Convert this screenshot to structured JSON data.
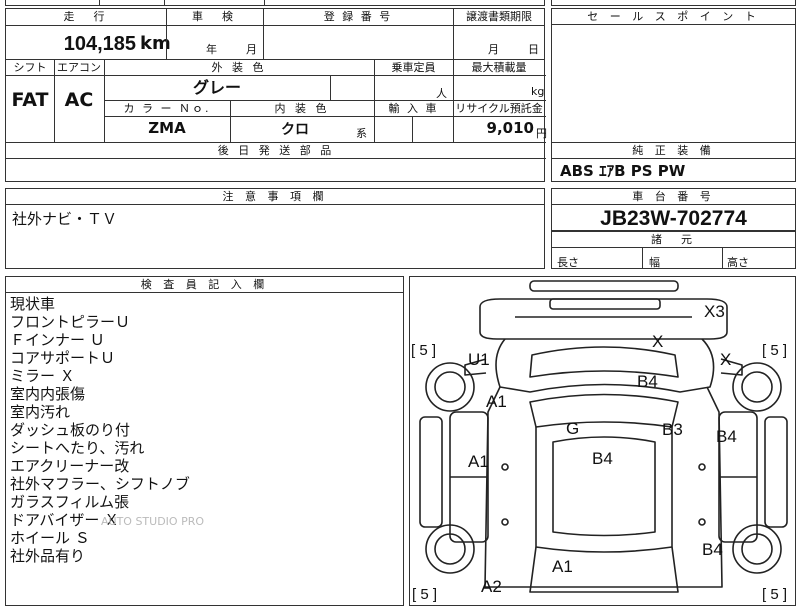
{
  "header": {
    "top_fragments": [
      "",
      "",
      ""
    ]
  },
  "vehicle_info": {
    "mileage_label": "走　行",
    "mileage_value": "104,185",
    "mileage_unit": "km",
    "inspection_label": "車　検",
    "inspection_year_unit": "年",
    "inspection_month_unit": "月",
    "registration_label": "登 録 番 号",
    "transfer_label": "譲渡書類期限",
    "transfer_month_unit": "月",
    "transfer_day_unit": "日",
    "shift_label": "シフト",
    "shift_value": "FAT",
    "aircon_label": "エアコン",
    "aircon_value": "AC",
    "exterior_color_label": "外 装 色",
    "exterior_color_value": "グレー",
    "capacity_label": "乗車定員",
    "capacity_unit": "人",
    "max_load_label": "最大積載量",
    "max_load_unit": "kg",
    "color_no_label": "カ ラ ー Ｎｏ.",
    "color_no_value": "ZMA",
    "interior_color_label": "内 装 色",
    "interior_color_value": "クロ",
    "interior_color_suffix": "系",
    "import_label": "輸 入 車",
    "recycle_label": "リサイクル預託金",
    "recycle_value": "9,010",
    "recycle_unit": "円",
    "later_parts_label": "後 日 発 送 部 品"
  },
  "sales_point": {
    "label": "セ ー ル ス ポ イ ン ト"
  },
  "equipment": {
    "label": "純 正 装 備",
    "value": "ABS  ｴｱB  PS  PW"
  },
  "caution": {
    "label": "注 意 事 項 欄",
    "value": "社外ナビ・ＴＶ"
  },
  "chassis": {
    "label": "車 台 番 号",
    "value": "JB23W-702774"
  },
  "dimensions": {
    "label": "諸　元",
    "length_label": "長さ",
    "width_label": "幅",
    "height_label": "高さ"
  },
  "inspector": {
    "label": "検 査 員 記 入 欄",
    "lines": [
      "現状車",
      "フロントピラーＵ",
      "Ｆインナー Ｕ",
      "コアサポートＵ",
      "ミラー Ｘ",
      "室内内張傷",
      "室内汚れ",
      "ダッシュ板のり付",
      "シートへたり、汚れ",
      "エアクリーナー改",
      "社外マフラー、シフトノブ",
      "ガラスフィルム張",
      "ドアバイザー Ｘ",
      "ホイール Ｓ",
      "社外品有り"
    ],
    "watermark": "AUTO STUDIO PRO"
  },
  "diagram": {
    "marks": [
      "X3",
      "X",
      "X",
      "U1",
      "B4",
      "A1",
      "G",
      "B3",
      "B4",
      "A1",
      "B4",
      "B4",
      "A1",
      "A2"
    ],
    "brackets": [
      "[ 5 ]",
      "[ 5 ]",
      "[ 5 ]",
      "[ 5 ]"
    ]
  }
}
